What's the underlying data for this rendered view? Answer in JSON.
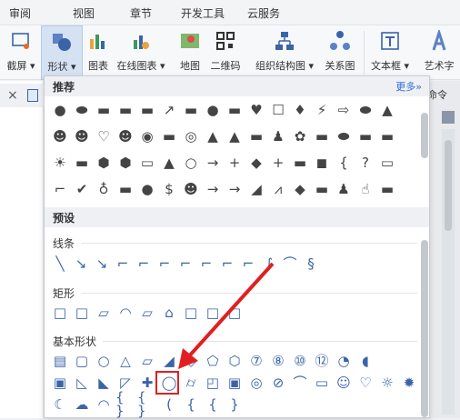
{
  "menu_tabs": [
    "审阅",
    "视图",
    "章节",
    "开发工具",
    "云服务"
  ],
  "ribbon_buttons": [
    {
      "label": "截屏 ▾",
      "icon": "screenshot-icon",
      "active": false
    },
    {
      "label": "形状 ▾",
      "icon": "shapes-icon",
      "active": true
    },
    {
      "label": "图表",
      "icon": "chart-icon",
      "active": false
    },
    {
      "label": "在线图表 ▾",
      "icon": "online-chart-icon",
      "active": false
    },
    {
      "label": "地图",
      "icon": "map-icon",
      "active": false
    },
    {
      "label": "二维码",
      "icon": "qrcode-icon",
      "active": false
    },
    {
      "label": "组织结构图 ▾",
      "icon": "org-chart-icon",
      "active": false
    },
    {
      "label": "关系图",
      "icon": "relation-diagram-icon",
      "active": false
    },
    {
      "label": "文本框 ▾",
      "icon": "textbox-icon",
      "active": false
    },
    {
      "label": "艺术字",
      "icon": "wordart-icon",
      "active": false
    }
  ],
  "right_pane": {
    "command_label": "命令"
  },
  "shapes_panel": {
    "recommended_title": "推荐",
    "more_label": "更多»",
    "presets_title": "预设",
    "categories": [
      {
        "title": "线条"
      },
      {
        "title": "矩形"
      },
      {
        "title": "基本形状"
      }
    ],
    "recommended_rows": [
      [
        "●",
        "⬬",
        "▬",
        "▬",
        "▬",
        "↗",
        "▬",
        "●",
        "▬",
        "♥",
        "☐",
        "♦",
        "⚡",
        "⇨",
        "⬬",
        "▲"
      ],
      [
        "☻",
        "☻",
        "♡",
        "☻",
        "◉",
        "▬",
        "◎",
        "▲",
        "▲",
        "▬",
        "♟",
        "✿",
        "▬",
        "⬬",
        "▬",
        "▬"
      ],
      [
        "☀",
        "▬",
        "⬢",
        "⬢",
        "▭",
        "▲",
        "○",
        "→",
        "+",
        "◆",
        "+",
        "▬",
        "◼",
        "{",
        "?",
        "▭"
      ],
      [
        "⌐",
        "✔",
        "♁",
        "▬",
        "●",
        "$",
        "☻",
        "→",
        "→",
        "◢",
        "⩘",
        "◆",
        "▬",
        "♟",
        "☝",
        "▬"
      ]
    ],
    "line_row": [
      "╲",
      "↘",
      "↘",
      "⌐",
      "⌐",
      "⌐",
      "⌐",
      "⌐",
      "⌐",
      "⌐",
      "∫",
      "⌒",
      "§"
    ],
    "rect_row": [
      "□",
      "□",
      "▱",
      "◠",
      "▱",
      "⌂",
      "□",
      "□",
      "□"
    ],
    "basic_rows": [
      [
        "▤",
        "▢",
        "○",
        "△",
        "▱",
        "◢",
        "◇",
        "⬠",
        "⬡",
        "⑦",
        "⑧",
        "⑩",
        "⑫",
        "◔",
        "◖"
      ],
      [
        "▣",
        "◺",
        "◣",
        "◸",
        "✚",
        "◯",
        "⌭",
        "◰",
        "▣",
        "◎",
        "⊘",
        "⌒",
        "▭",
        "☺",
        "♡",
        "☼",
        "✹"
      ],
      [
        "☾",
        "☁",
        "◠",
        "{ }",
        "{ }",
        "(",
        "{",
        "{",
        "}"
      ]
    ],
    "selected_shape": "octagon"
  },
  "colors": {
    "accent": "#3b64a8",
    "highlight": "#e02020",
    "active_bg": "#d5e2f3"
  }
}
